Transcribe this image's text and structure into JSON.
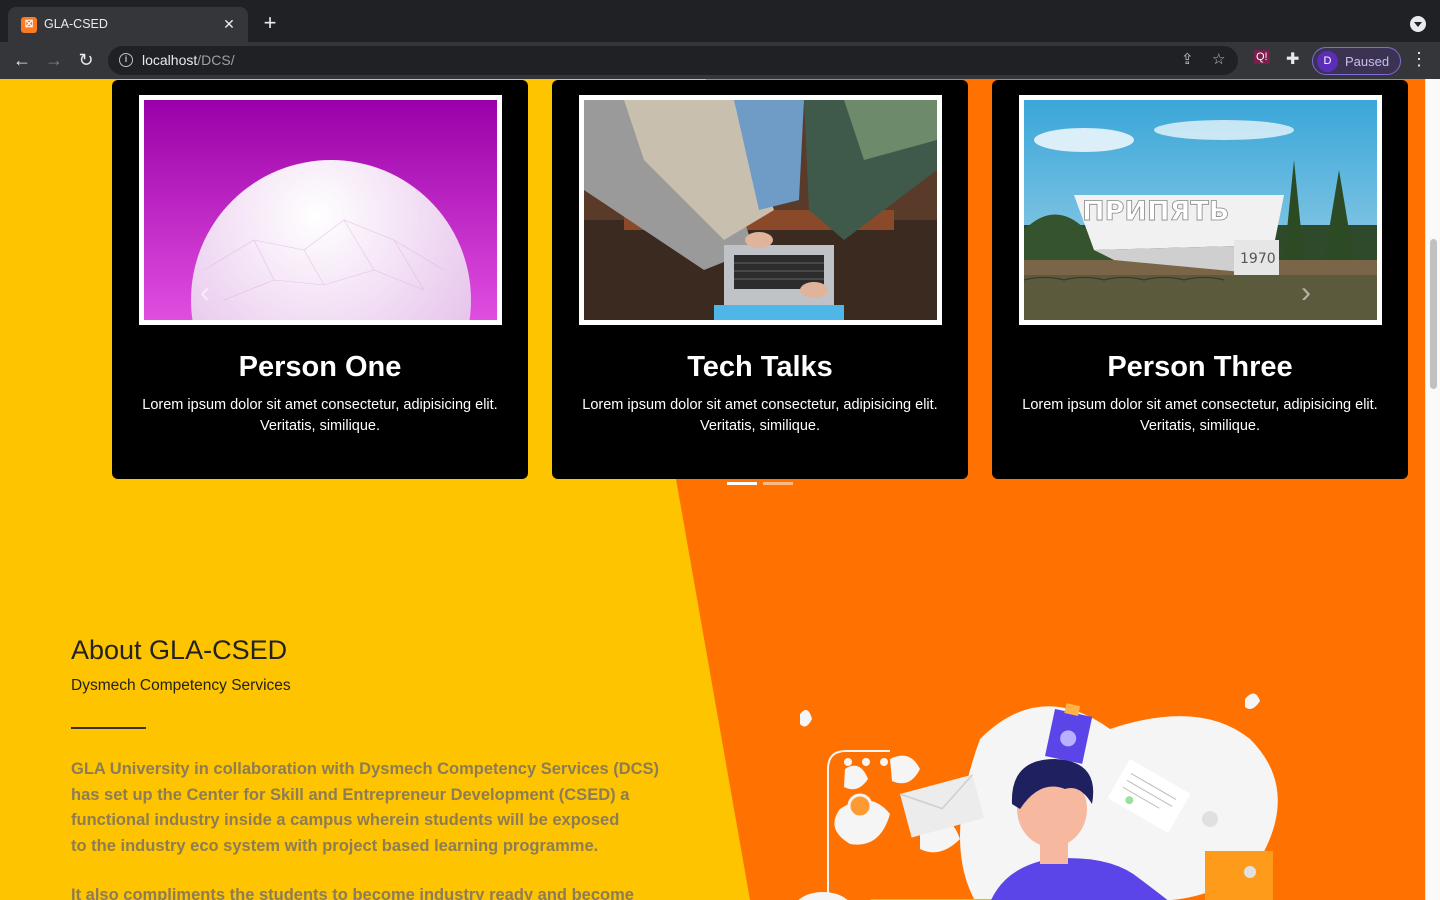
{
  "browser": {
    "tab_title": "GLA-CSED",
    "tab_favicon_glyph": "⛝",
    "url_host": "localhost",
    "url_path": "/DCS/",
    "profile_initial": "D",
    "profile_label": "Paused",
    "extension_badge": "Q!",
    "colors": {
      "chrome_dark": "#202124",
      "chrome_toolbar": "#35363a",
      "profile_accent": "#5b2db8"
    }
  },
  "carousel": {
    "cards": [
      {
        "title": "Person One",
        "text": "Lorem ipsum dolor sit amet consectetur, adipisicing elit. Veritatis, similique.",
        "image": "magenta-sphere-photo"
      },
      {
        "title": "Tech Talks",
        "text": "Lorem ipsum dolor sit amet consectetur, adipisicing elit. Veritatis, similique.",
        "image": "laptop-group-photo"
      },
      {
        "title": "Person Three",
        "text": "Lorem ipsum dolor sit amet consectetur, adipisicing elit. Veritatis, similique.",
        "image": "city-sign-photo",
        "sign_text": "ПРИПЯТЬ",
        "sign_year": "1970"
      }
    ],
    "prev_icon": "chevron-left-icon",
    "next_icon": "chevron-right-icon",
    "active_indicator": 0,
    "indicator_count": 2
  },
  "about": {
    "title": "About GLA-CSED",
    "subtitle": "Dysmech Competency Services",
    "paragraph_lines": [
      "GLA University in collaboration with Dysmech Competency Services (DCS)",
      "has set up the Center for Skill and Entrepreneur Development (CSED) a",
      "functional industry inside a campus wherein students will be exposed",
      "to the industry eco system with project based learning programme."
    ],
    "paragraph2": "It also compliments the students to  become industry ready and become"
  },
  "colors": {
    "yellow": "#fec400",
    "orange": "#ff7100",
    "card_bg": "#000000",
    "person_shirt": "#5b45e8"
  }
}
